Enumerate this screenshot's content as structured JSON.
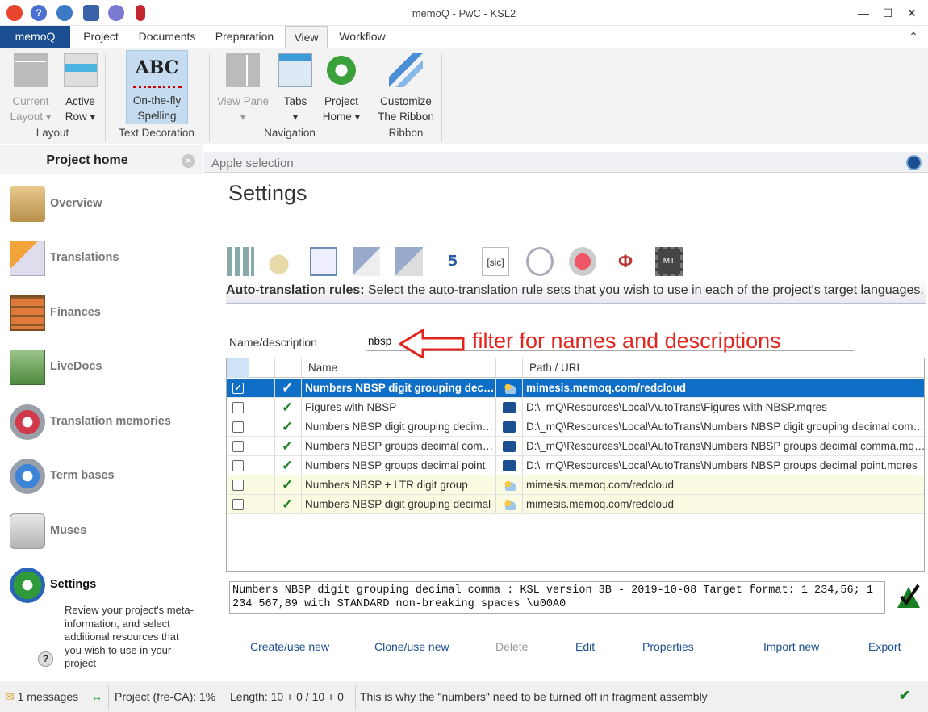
{
  "window": {
    "title": "memoQ - PwC - KSL2"
  },
  "quick_access": [
    "memoq-logo-icon",
    "help-icon",
    "options-icon",
    "resource-console-icon",
    "cloud-icon",
    "microphone-icon"
  ],
  "menu_tabs": [
    {
      "label": "memoQ"
    },
    {
      "label": "Project"
    },
    {
      "label": "Documents"
    },
    {
      "label": "Preparation"
    },
    {
      "label": "View"
    },
    {
      "label": "Workflow"
    }
  ],
  "ribbon": {
    "buttons": [
      {
        "label1": "Current",
        "label2": "Layout ▾"
      },
      {
        "label1": "Active",
        "label2": "Row ▾"
      },
      {
        "label1": "On-the-fly",
        "label2": "Spelling"
      },
      {
        "label1": "View Pane",
        "label2": "▾"
      },
      {
        "label1": "Tabs",
        "label2": "▾"
      },
      {
        "label1": "Project",
        "label2": "Home ▾"
      },
      {
        "label1": "Customize",
        "label2": "The Ribbon"
      }
    ],
    "abc_text": "ABC",
    "groups": [
      "Layout",
      "Text Decoration",
      "Navigation",
      "Ribbon"
    ]
  },
  "left_panel": {
    "title": "Project home",
    "items": [
      {
        "label": "Overview"
      },
      {
        "label": "Translations"
      },
      {
        "label": "Finances"
      },
      {
        "label": "LiveDocs"
      },
      {
        "label": "Translation memories"
      },
      {
        "label": "Term bases"
      },
      {
        "label": "Muses"
      },
      {
        "label": "Settings"
      }
    ],
    "settings_desc": "Review your project's meta-information, and select additional resources that you wish to use in your project"
  },
  "doc_tab": {
    "label": "Apple selection"
  },
  "settings": {
    "title": "Settings",
    "info_bold": "Auto-translation rules:",
    "info_text": " Select the auto-translation rule sets that you wish to use in each of the project's target languages.",
    "mt_label": "MT"
  },
  "filter": {
    "label": "Name/description",
    "value": "nbsp",
    "annotation": "filter for names and descriptions"
  },
  "grid": {
    "headers": {
      "name": "Name",
      "path": "Path / URL"
    },
    "rows": [
      {
        "name": "Numbers NBSP digit grouping decimal comma",
        "path": "mimesis.memoq.com/redcloud",
        "kind": "cloud",
        "selected": true
      },
      {
        "name": "Figures with NBSP",
        "path": "D:\\_mQ\\Resources\\Local\\AutoTrans\\Figures with NBSP.mqres",
        "kind": "local",
        "selected": false
      },
      {
        "name": "Numbers NBSP digit grouping decimal comma",
        "path": "D:\\_mQ\\Resources\\Local\\AutoTrans\\Numbers NBSP digit grouping decimal comma.mqres",
        "kind": "local",
        "selected": false
      },
      {
        "name": "Numbers NBSP groups decimal comma",
        "path": "D:\\_mQ\\Resources\\Local\\AutoTrans\\Numbers NBSP groups decimal comma.mqres",
        "kind": "local",
        "selected": false
      },
      {
        "name": "Numbers NBSP groups decimal point",
        "path": "D:\\_mQ\\Resources\\Local\\AutoTrans\\Numbers NBSP groups decimal point.mqres",
        "kind": "local",
        "selected": false
      },
      {
        "name": "Numbers NBSP + LTR digit group",
        "path": "mimesis.memoq.com/redcloud",
        "kind": "cloud",
        "selected": false
      },
      {
        "name": "Numbers NBSP digit grouping decimal",
        "path": "mimesis.memoq.com/redcloud",
        "kind": "cloud",
        "selected": false
      }
    ]
  },
  "description": "Numbers NBSP digit grouping decimal comma : KSL version 3B - 2019-10-08 Target format: 1 234,56; 1 234 567,89 with STANDARD non-breaking spaces \\u00A0",
  "actions": [
    "Create/use new",
    "Clone/use new",
    "Delete",
    "Edit",
    "Properties",
    "Import new",
    "Export"
  ],
  "status": {
    "messages": "1 messages",
    "project": "Project (fre-CA): 1%",
    "length": "Length: 10 + 0 / 10 + 0",
    "note": "This is why the \"numbers\" need to be turned off in fragment assembly"
  }
}
